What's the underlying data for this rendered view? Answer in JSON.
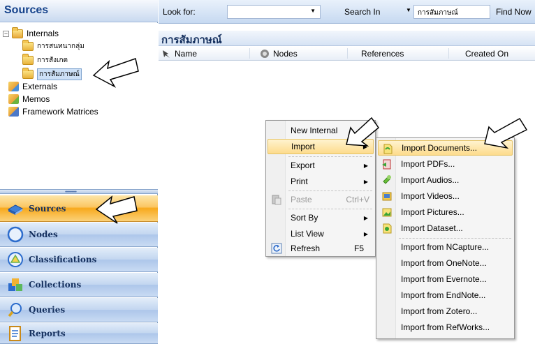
{
  "left_panel": {
    "title": "Sources",
    "tree": {
      "internals": {
        "label": "Internals",
        "expander": "−"
      },
      "children": [
        "การสนทนากลุ่ม",
        "การสังเกต",
        "การสัมภาษณ์"
      ],
      "externals": "Externals",
      "memos": "Memos",
      "framework": "Framework Matrices"
    },
    "nav": [
      {
        "label": "Sources",
        "icon": "sources-icon",
        "active": true
      },
      {
        "label": "Nodes",
        "icon": "nodes-icon"
      },
      {
        "label": "Classifications",
        "icon": "classifications-icon"
      },
      {
        "label": "Collections",
        "icon": "collections-icon"
      },
      {
        "label": "Queries",
        "icon": "queries-icon"
      },
      {
        "label": "Reports",
        "icon": "reports-icon"
      }
    ]
  },
  "find_bar": {
    "look_for_label": "Look for:",
    "look_for_value": "",
    "search_in_label": "Search In",
    "search_in_value": "การสัมภาษณ์",
    "find_now": "Find Now"
  },
  "list_view": {
    "title": "การสัมภาษณ์",
    "columns": [
      "Name",
      "Nodes",
      "References",
      "Created On"
    ]
  },
  "context_menu": {
    "items": [
      {
        "label": "New Internal"
      },
      {
        "label": "Import",
        "submenu": true
      },
      {
        "label": "Export",
        "submenu": true
      },
      {
        "label": "Print",
        "submenu": true
      },
      {
        "label": "Paste",
        "shortcut": "Ctrl+V",
        "disabled": true
      },
      {
        "label": "Sort By",
        "submenu": true
      },
      {
        "label": "List View",
        "submenu": true
      },
      {
        "label": "Refresh",
        "shortcut": "F5"
      }
    ]
  },
  "import_submenu": {
    "items": [
      "Import Documents...",
      "Import PDFs...",
      "Import Audios...",
      "Import Videos...",
      "Import Pictures...",
      "Import Dataset...",
      "Import from NCapture...",
      "Import from OneNote...",
      "Import from Evernote...",
      "Import from EndNote...",
      "Import from Zotero...",
      "Import from RefWorks..."
    ]
  },
  "colors": {
    "panel_title": "#15428b",
    "active_nav": "#f8a91c",
    "nav": "#c2d6f0",
    "menu_hover": "#fddb8c"
  }
}
